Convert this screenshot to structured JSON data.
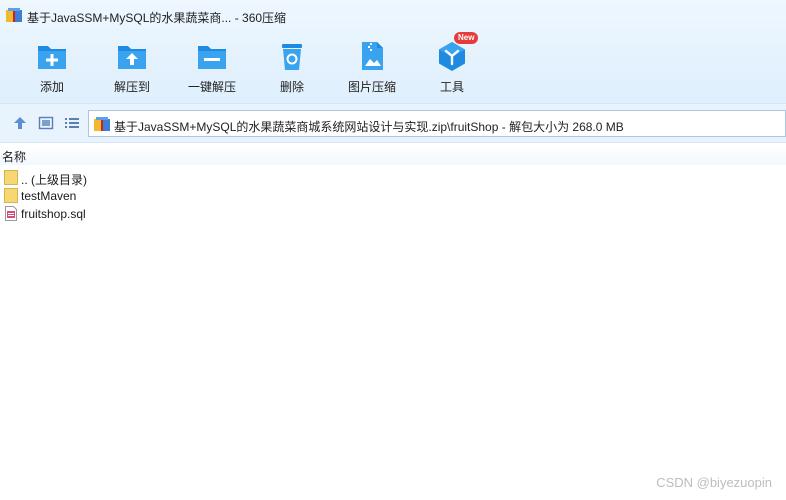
{
  "window": {
    "title": "基于JavaSSM+MySQL的水果蔬菜商... - 360压缩"
  },
  "toolbar": {
    "buttons": [
      {
        "label": "添加",
        "icon": "add-icon"
      },
      {
        "label": "解压到",
        "icon": "extract-to-icon"
      },
      {
        "label": "一键解压",
        "icon": "one-click-extract-icon"
      },
      {
        "label": "删除",
        "icon": "delete-icon"
      },
      {
        "label": "图片压缩",
        "icon": "image-compress-icon"
      },
      {
        "label": "工具",
        "icon": "tools-icon"
      }
    ],
    "tools_badge": "New"
  },
  "address": {
    "path": "基于JavaSSM+MySQL的水果蔬菜商城系统网站设计与实现.zip\\fruitShop - 解包大小为 268.0 MB"
  },
  "list": {
    "column_name": "名称",
    "items": [
      {
        "name": ".. (上级目录)",
        "type": "folder"
      },
      {
        "name": "testMaven",
        "type": "folder"
      },
      {
        "name": "fruitshop.sql",
        "type": "sql-file"
      }
    ]
  },
  "watermark": "CSDN @biyezuopin",
  "colors": {
    "accent_blue": "#1e8be0",
    "badge_red": "#e63b3b",
    "folder_yellow": "#f7d774"
  }
}
